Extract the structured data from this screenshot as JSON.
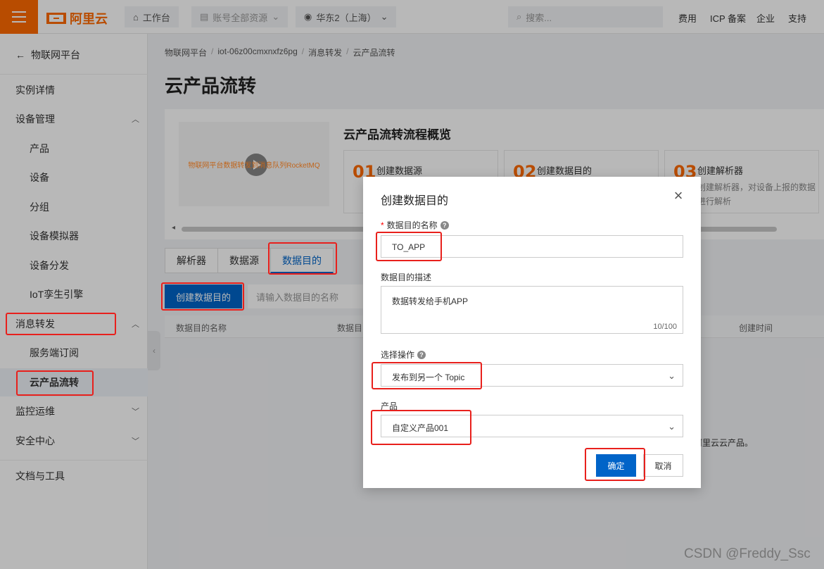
{
  "topbar": {
    "brand": "阿里云",
    "workbench": "工作台",
    "resources": "账号全部资源",
    "region": "华东2（上海）",
    "search_placeholder": "搜索...",
    "links": [
      "费用",
      "ICP 备案",
      "企业",
      "支持"
    ]
  },
  "sidebar": {
    "back_label": "物联网平台",
    "items": [
      {
        "label": "实例详情"
      },
      {
        "label": "设备管理"
      },
      {
        "label": "产品"
      },
      {
        "label": "设备"
      },
      {
        "label": "分组"
      },
      {
        "label": "设备模拟器"
      },
      {
        "label": "设备分发"
      },
      {
        "label": "IoT孪生引擎"
      },
      {
        "label": "消息转发"
      },
      {
        "label": "服务端订阅"
      },
      {
        "label": "云产品流转"
      },
      {
        "label": "监控运维"
      },
      {
        "label": "安全中心"
      },
      {
        "label": "文档与工具"
      }
    ]
  },
  "breadcrumb": [
    "物联网平台",
    "iot-06z00cmxnxfz6pg",
    "消息转发",
    "云产品流转"
  ],
  "page_title": "云产品流转",
  "overview": {
    "video_caption": "物联网平台数据转发到消息队列RocketMQ",
    "title": "云产品流转流程概览",
    "steps": [
      {
        "num": "01",
        "label": "创建数据源",
        "desc": ""
      },
      {
        "num": "02",
        "label": "创建数据目的",
        "desc": ""
      },
      {
        "num": "03",
        "label": "创建解析器",
        "desc": "创建解析器，对设备上报的数据进行解析"
      }
    ]
  },
  "tabs": [
    "解析器",
    "数据源",
    "数据目的"
  ],
  "toolbar": {
    "create_button": "创建数据目的",
    "search_placeholder": "请输入数据目的名称"
  },
  "table": {
    "columns": [
      "数据目的名称",
      "数据目",
      "创建时间"
    ],
    "empty_hint": "阿里云云产品。"
  },
  "modal": {
    "title": "创建数据目的",
    "name_label": "数据目的名称",
    "name_value": "TO_APP",
    "desc_label": "数据目的描述",
    "desc_value": "数据转发给手机APP",
    "desc_count": "10/100",
    "action_label": "选择操作",
    "action_value": "发布到另一个 Topic",
    "product_label": "产品",
    "product_value": "自定义产品001",
    "ok_button": "确定",
    "cancel_button": "取消"
  },
  "watermark": "CSDN @Freddy_Ssc",
  "colors": {
    "brand": "#ff6a00",
    "primary": "#0064c8",
    "annotation": "#e8201c"
  }
}
